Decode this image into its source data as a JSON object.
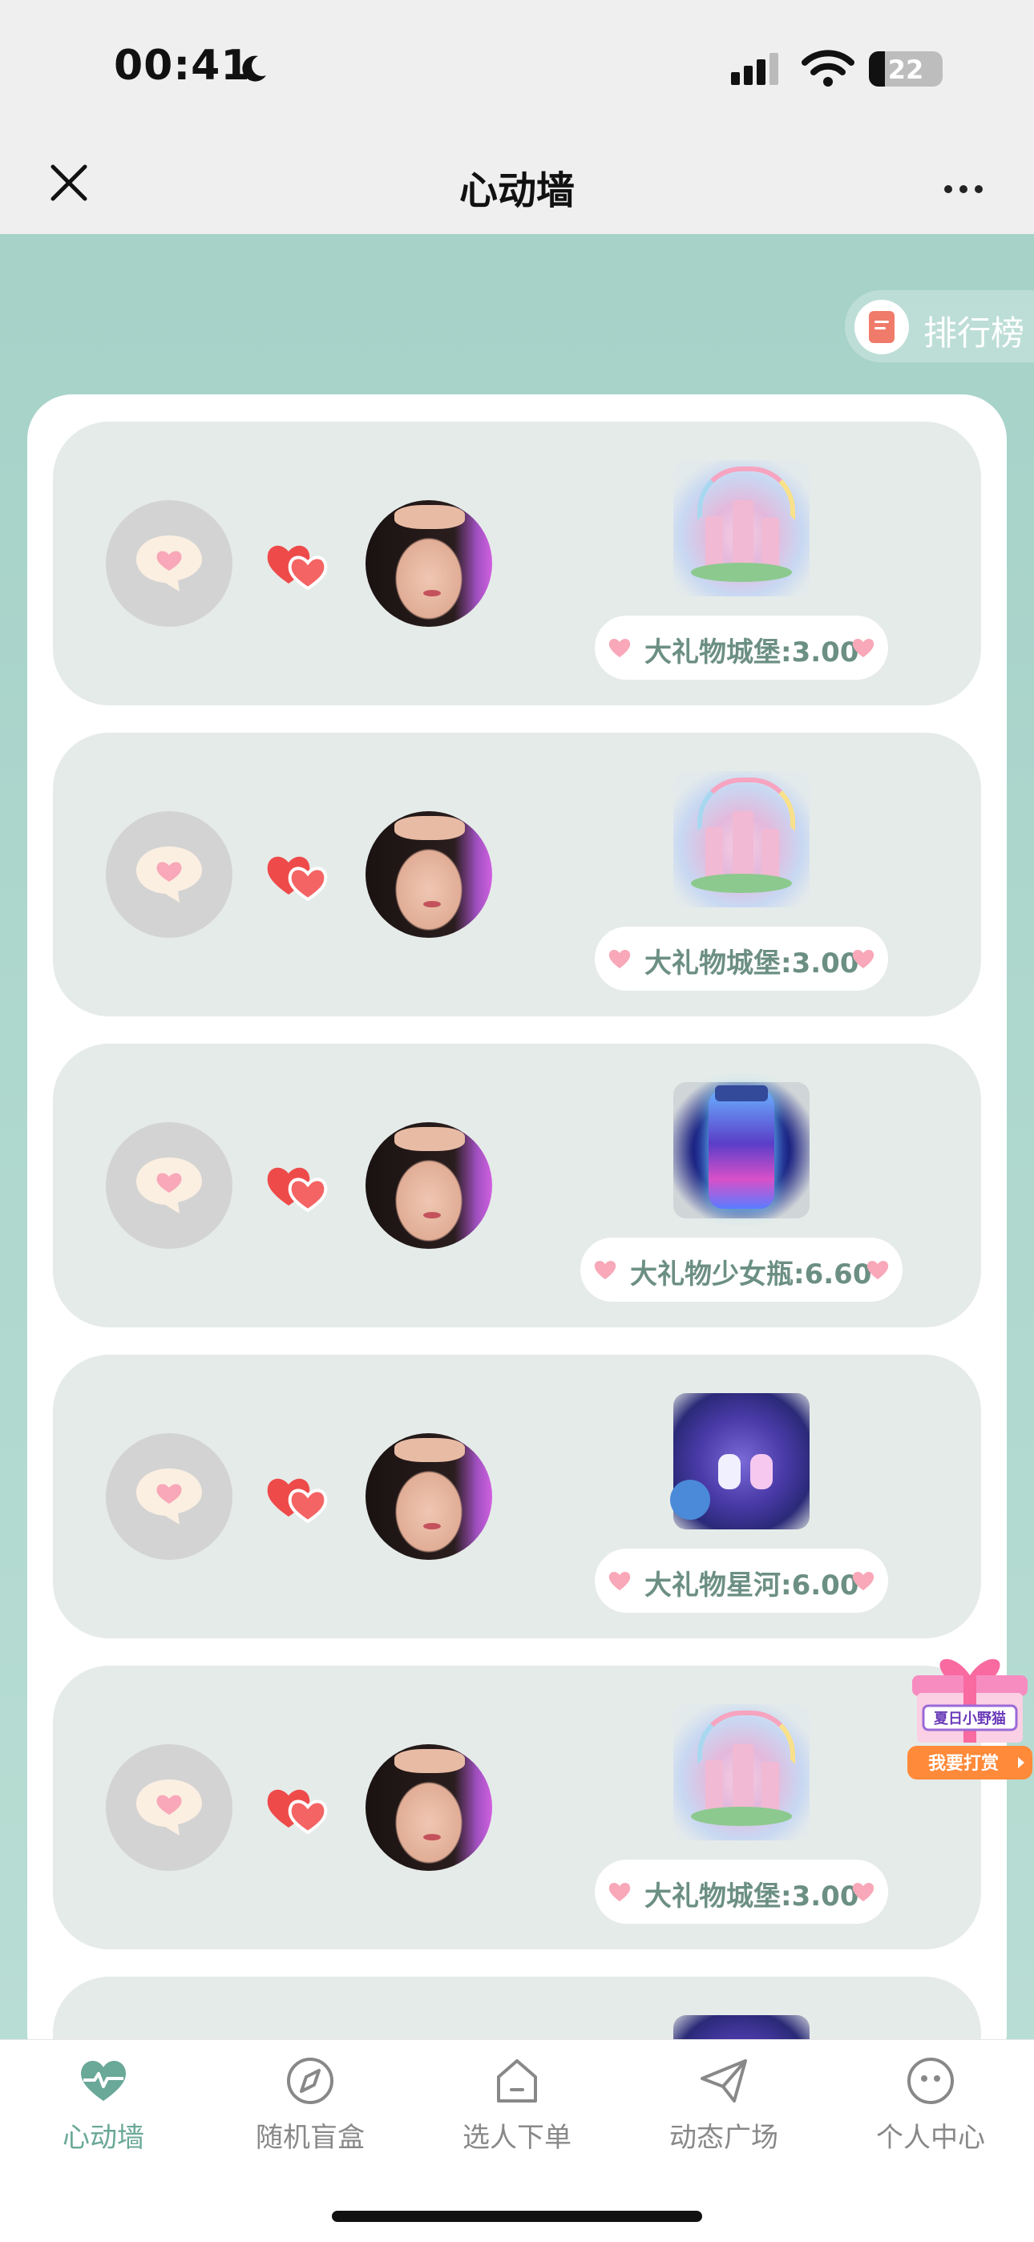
{
  "status": {
    "time": "00:41",
    "battery": "22",
    "battery_level_pct": 22
  },
  "header": {
    "title": "心动墙"
  },
  "ranking": {
    "label": "排行榜"
  },
  "cards": [
    {
      "gift_type": "castle",
      "label": "大礼物城堡:3.00"
    },
    {
      "gift_type": "castle",
      "label": "大礼物城堡:3.00"
    },
    {
      "gift_type": "bottle",
      "label": "大礼物少女瓶:6.60"
    },
    {
      "gift_type": "galaxy",
      "label": "大礼物星河:6.00"
    },
    {
      "gift_type": "castle",
      "label": "大礼物城堡:3.00"
    },
    {
      "gift_type": "galaxy",
      "label": ""
    }
  ],
  "float_banner": {
    "top": "夏日小野猫",
    "button": "我要打赏"
  },
  "tabs": [
    {
      "label": "心动墙",
      "icon": "heart-pulse-icon",
      "active": true
    },
    {
      "label": "随机盲盒",
      "icon": "compass-icon",
      "active": false
    },
    {
      "label": "选人下单",
      "icon": "home-icon",
      "active": false
    },
    {
      "label": "动态广场",
      "icon": "paper-plane-icon",
      "active": false
    },
    {
      "label": "个人中心",
      "icon": "face-icon",
      "active": false
    }
  ],
  "colors": {
    "accent": "#6aa898",
    "background": "#a6d2c8",
    "heart": "#ee4a4a"
  }
}
